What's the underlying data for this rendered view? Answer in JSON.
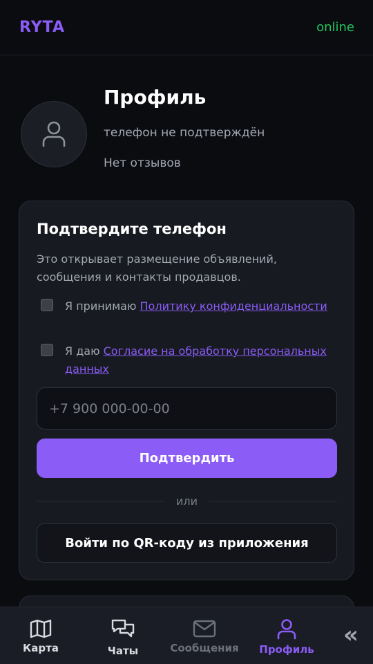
{
  "header": {
    "logo": "RYTA",
    "status": "online",
    "status_color": "#22c55e",
    "brand_color": "#8b5cf6"
  },
  "profile": {
    "avatar_icon": "user-icon",
    "title": "Профиль",
    "phone_status": "телефон не подтверждён",
    "reviews": "Нет отзывов"
  },
  "verify_card": {
    "title": "Подтвердите телефон",
    "description": "Это открывает размещение объявлений, сообщения и контакты продавцов.",
    "consent_privacy": {
      "prefix": "Я принимаю ",
      "link": "Политику конфиденциальности",
      "checked": false
    },
    "consent_data": {
      "prefix": "Я даю ",
      "link": "Согласие на обработку персональных данных",
      "checked": false
    },
    "phone_placeholder": "+7 900 000-00-00",
    "phone_value": "",
    "submit_label": "Подтвердить",
    "divider_text": "или",
    "qr_login_label": "Войти по QR-коду из приложения"
  },
  "bottom_nav": {
    "items": [
      {
        "label": "Карта",
        "icon": "map-icon",
        "active": false
      },
      {
        "label": "Чаты",
        "icon": "chats-icon",
        "active": false
      },
      {
        "label": "Сообщения",
        "icon": "envelope-icon",
        "active": false,
        "disabled": true
      },
      {
        "label": "Профиль",
        "icon": "user-icon",
        "active": true
      }
    ],
    "collapse_glyph": "«"
  }
}
